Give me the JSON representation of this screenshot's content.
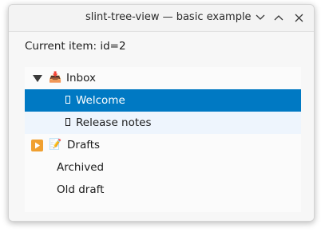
{
  "window": {
    "title": "slint-tree-view — basic example"
  },
  "titlebar_buttons": {
    "minimize": "minimize-icon",
    "maximize": "maximize-icon",
    "close": "close-icon"
  },
  "status": {
    "current_item": "Current item: id=2"
  },
  "tree": {
    "items": [
      {
        "label": "Inbox",
        "icon": "📥",
        "expander": "expanded",
        "state": "normal"
      },
      {
        "label": "Welcome",
        "icon": "document-icon",
        "state": "selected"
      },
      {
        "label": "Release notes",
        "icon": "document-icon",
        "state": "hover"
      },
      {
        "label": "Drafts",
        "icon": "📝",
        "expander": "collapsed",
        "state": "normal"
      },
      {
        "label": "Archived",
        "state": "normal"
      },
      {
        "label": "Old draft",
        "state": "normal"
      }
    ]
  },
  "colors": {
    "selected_background": "#0079c3",
    "hover_background": "#eef5fd",
    "collapsed_toggle": "#f0a030"
  }
}
